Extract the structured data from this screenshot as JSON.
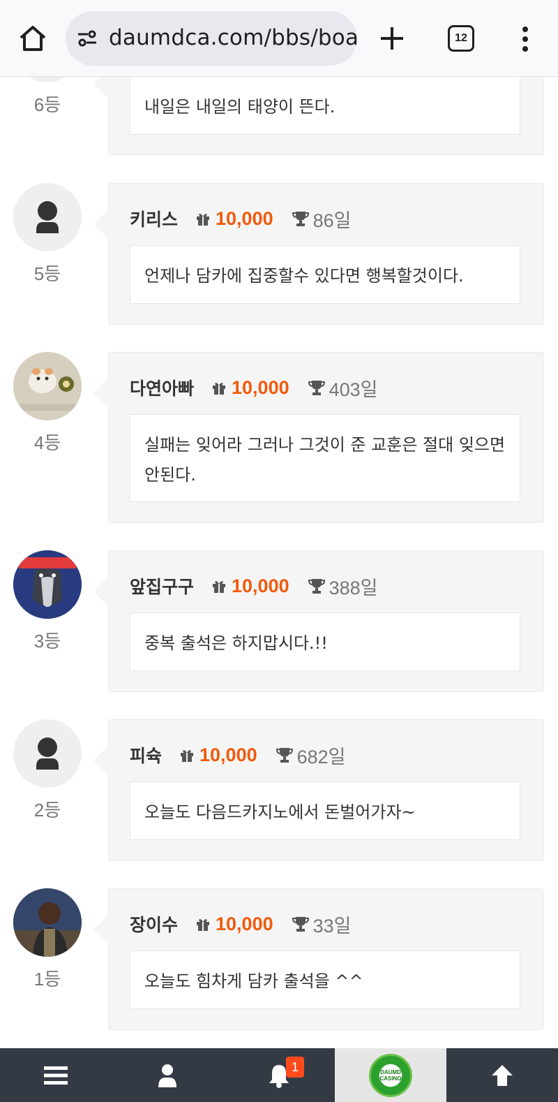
{
  "browser": {
    "url": "daumdca.com/bbs/board",
    "tab_count": "12"
  },
  "entries": [
    {
      "rank": "6등",
      "nick": "",
      "points": "",
      "days": "",
      "message": "내일은 내일의 태양이 뜬다.",
      "avatar": "default"
    },
    {
      "rank": "5등",
      "nick": "키리스",
      "points": "10,000",
      "days": "86일",
      "message": "언제나 담카에 집중할수 있다면 행복할것이다.",
      "avatar": "default"
    },
    {
      "rank": "4등",
      "nick": "다연아빠",
      "points": "10,000",
      "days": "403일",
      "message": "실패는 잊어라 그러나 그것이 준 교훈은 절대 잊으면 안된다.",
      "avatar": "hamster-photo"
    },
    {
      "rank": "3등",
      "nick": "앞집구구",
      "points": "10,000",
      "days": "388일",
      "message": "중복 출석은 하지맙시다.!!",
      "avatar": "penguin-photo"
    },
    {
      "rank": "2등",
      "nick": "피슉",
      "points": "10,000",
      "days": "682일",
      "message": "오늘도 다음드카지노에서 돈벌어가자~",
      "avatar": "default"
    },
    {
      "rank": "1등",
      "nick": "장이수",
      "points": "10,000",
      "days": "33일",
      "message": "오늘도 힘차게 담카 출석을 ^^",
      "avatar": "man-photo"
    }
  ],
  "bottom_nav": {
    "notification_count": "1",
    "logo_text_1": "DAUMD",
    "logo_text_2": "CASINO"
  },
  "colors": {
    "accent_points": "#f15a0c",
    "nav_bg": "#343a44",
    "card_bg": "#f5f5f5"
  }
}
